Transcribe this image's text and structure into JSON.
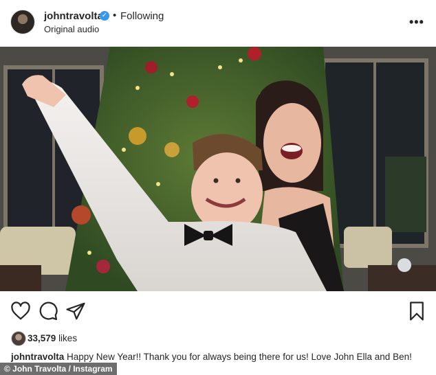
{
  "post": {
    "username": "johntravolta",
    "verified_badge": "✓",
    "separator": "•",
    "follow_status": "Following",
    "audio_label": "Original audio",
    "more_glyph": "•••",
    "likes_count": "33,579",
    "likes_label": "likes",
    "caption_user": "johntravolta",
    "caption_text": "Happy New Year!! Thank you for always being there for us! Love John Ella and Ben!"
  },
  "actions": {
    "icons": [
      "heart-icon",
      "comment-icon",
      "share-icon",
      "bookmark-icon"
    ]
  },
  "credit": {
    "text": "© John Travolta / Instagram"
  },
  "colors": {
    "verified": "#3897f0",
    "text": "#262626"
  }
}
